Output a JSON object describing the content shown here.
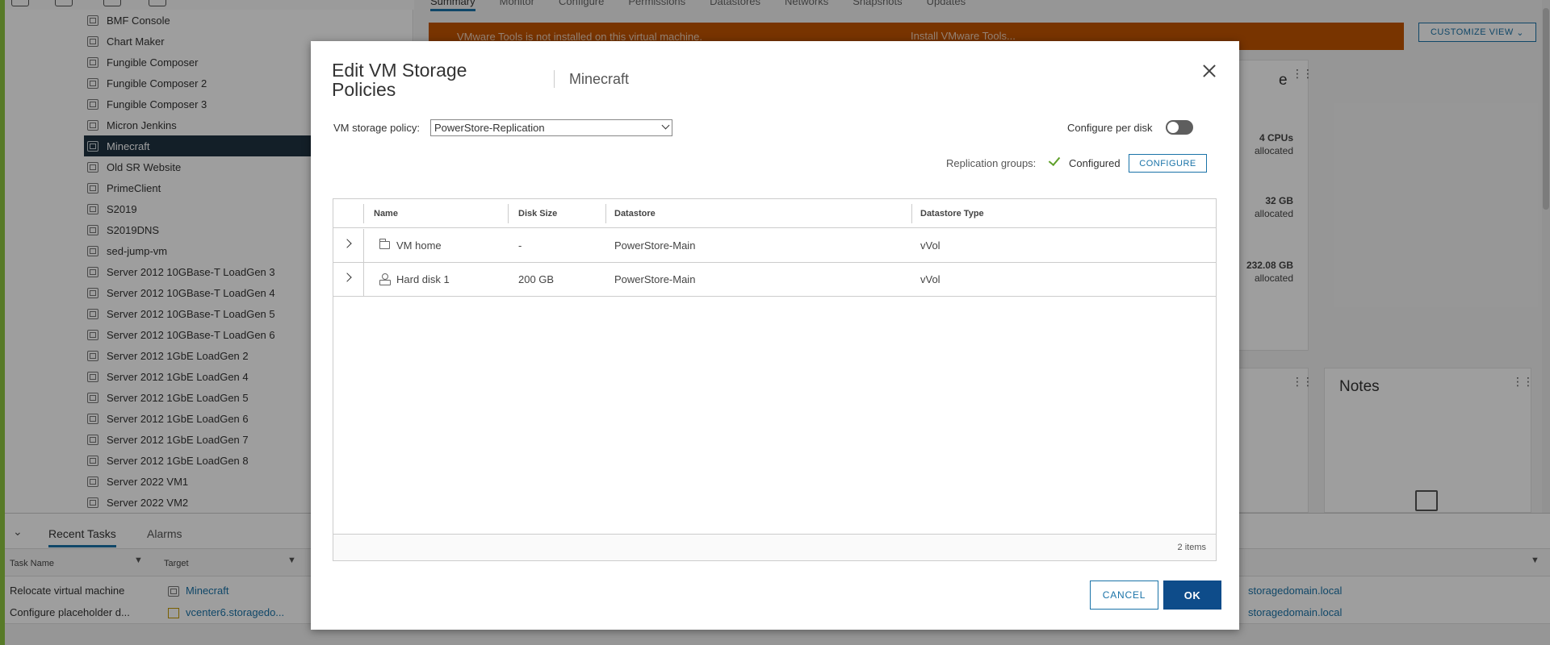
{
  "tree": {
    "items": [
      {
        "label": "BMF Console"
      },
      {
        "label": "Chart Maker"
      },
      {
        "label": "Fungible Composer"
      },
      {
        "label": "Fungible Composer 2"
      },
      {
        "label": "Fungible Composer 3"
      },
      {
        "label": "Micron Jenkins"
      },
      {
        "label": "Minecraft",
        "selected": true
      },
      {
        "label": "Old SR Website"
      },
      {
        "label": "PrimeClient"
      },
      {
        "label": "S2019"
      },
      {
        "label": "S2019DNS"
      },
      {
        "label": "sed-jump-vm"
      },
      {
        "label": "Server 2012 10GBase-T LoadGen 3"
      },
      {
        "label": "Server 2012 10GBase-T LoadGen 4"
      },
      {
        "label": "Server 2012 10GBase-T LoadGen 5"
      },
      {
        "label": "Server 2012 10GBase-T LoadGen 6"
      },
      {
        "label": "Server 2012 1GbE LoadGen 2"
      },
      {
        "label": "Server 2012 1GbE LoadGen 4"
      },
      {
        "label": "Server 2012 1GbE LoadGen 5"
      },
      {
        "label": "Server 2012 1GbE LoadGen 6"
      },
      {
        "label": "Server 2012 1GbE LoadGen 7"
      },
      {
        "label": "Server 2012 1GbE LoadGen 8"
      },
      {
        "label": "Server 2022 VM1"
      },
      {
        "label": "Server 2022 VM2"
      }
    ]
  },
  "tabs": [
    "Summary",
    "Monitor",
    "Configure",
    "Permissions",
    "Datastores",
    "Networks",
    "Snapshots",
    "Updates"
  ],
  "warning": {
    "text": "VMware Tools is not installed on this virtual machine.",
    "action": "Install VMware Tools..."
  },
  "customize_view": "CUSTOMIZE VIEW",
  "capacity": {
    "cpu_value": "4 CPUs",
    "cpu_sub": "allocated",
    "mem_value": "32 GB",
    "mem_sub": "allocated",
    "storage_value": "232.08 GB",
    "storage_sub": "allocated",
    "partial_title": "e"
  },
  "notes": {
    "title": "Notes"
  },
  "bottom": {
    "tabs": [
      "Recent Tasks",
      "Alarms"
    ],
    "columns": [
      "Task Name",
      "Target"
    ],
    "rows": [
      {
        "task": "Relocate virtual machine",
        "target": "Minecraft",
        "server": "storagedomain.local"
      },
      {
        "task": "Configure placeholder d...",
        "target": "vcenter6.storagedo...",
        "server": "storagedomain.local"
      }
    ]
  },
  "modal": {
    "title": "Edit VM Storage Policies",
    "subtitle": "Minecraft",
    "policy_label": "VM storage policy:",
    "policy_value": "PowerStore-Replication",
    "per_disk_label": "Configure per disk",
    "per_disk_enabled": false,
    "replication_label": "Replication groups:",
    "replication_status": "Configured",
    "configure_button": "CONFIGURE",
    "grid": {
      "columns": [
        "Name",
        "Disk Size",
        "Datastore",
        "Datastore Type"
      ],
      "rows": [
        {
          "name": "VM home",
          "icon": "folder-icon",
          "size": "-",
          "datastore": "PowerStore-Main",
          "type": "vVol"
        },
        {
          "name": "Hard disk 1",
          "icon": "hard-disk-icon",
          "size": "200 GB",
          "datastore": "PowerStore-Main",
          "type": "vVol"
        }
      ],
      "footer": "2 items"
    },
    "cancel_button": "CANCEL",
    "ok_button": "OK"
  }
}
